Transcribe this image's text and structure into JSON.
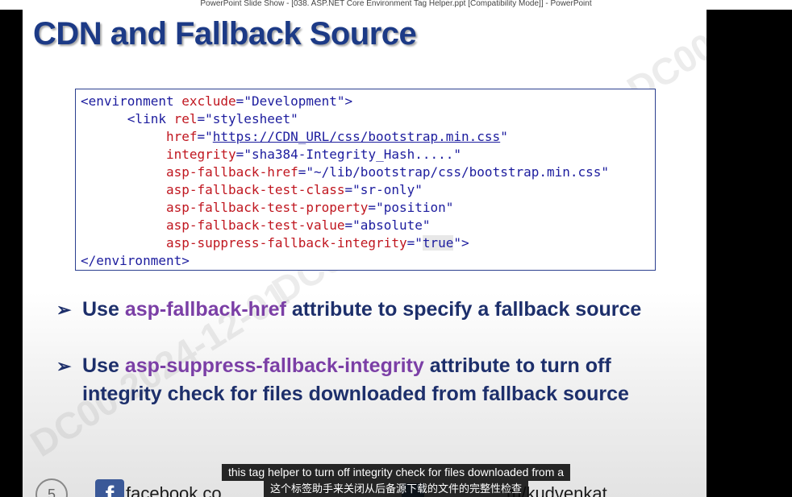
{
  "window": {
    "title": "PowerPoint Slide Show - [038. ASP.NET Core Environment Tag Helper.ppt [Compatibility Mode]] - PowerPoint"
  },
  "slide": {
    "title": "CDN and Fallback Source",
    "code": {
      "line1_open": "<environment ",
      "line1_attr": "exclude",
      "line1_eq": "=",
      "line1_val": "\"Development\"",
      "line1_close": ">",
      "line2_open": "<link ",
      "line2_attr": "rel",
      "line2_eq": "=",
      "line2_val": "\"stylesheet\"",
      "line3_attr": "href",
      "line3_eq": "=\"",
      "line3_link": "https://CDN_URL/css/bootstrap.min.css",
      "line3_end": "\"",
      "line4_attr": "integrity",
      "line4_eq": "=",
      "line4_val": "\"sha384-Integrity_Hash.....\"",
      "line5_attr": "asp-fallback-href",
      "line5_eq": "=",
      "line5_val": "\"~/lib/bootstrap/css/bootstrap.min.css\"",
      "line6_attr": "asp-fallback-test-class",
      "line6_eq": "=",
      "line6_val": "\"sr-only\"",
      "line7_attr": "asp-fallback-test-property",
      "line7_eq": "=",
      "line7_val": "\"position\"",
      "line8_attr": "asp-fallback-test-value",
      "line8_eq": "=",
      "line8_val": "\"absolute\"",
      "line9_attr": "asp-suppress-fallback-integrity",
      "line9_eq": "=\"",
      "line9_val": "true",
      "line9_end": "\">",
      "line10": "</environment>"
    },
    "bullets": [
      {
        "pre": "Use ",
        "highlight": "asp-fallback-href",
        "post": " attribute to specify a fallback source"
      },
      {
        "pre": "Use ",
        "highlight": "asp-suppress-fallback-integrity",
        "post": " attribute to turn off",
        "line2": "integrity check for files downloaded from fallback source"
      }
    ],
    "slide_number": "5",
    "footer_facebook": "facebook.co",
    "footer_youtube": "m/kudvenkat",
    "watermark": "DC00 2024-12-01"
  },
  "captions": {
    "english": "this tag helper to turn off integrity check for files downloaded from a",
    "chinese": "这个标签助手来关闭从后备源下载的文件的完整性检查"
  },
  "colors": {
    "title": "#1c3a86",
    "tag": "#1c1c9e",
    "attribute": "#c0161f",
    "bullet_text": "#1d2f6b",
    "bullet_highlight": "#7b3fa6"
  }
}
